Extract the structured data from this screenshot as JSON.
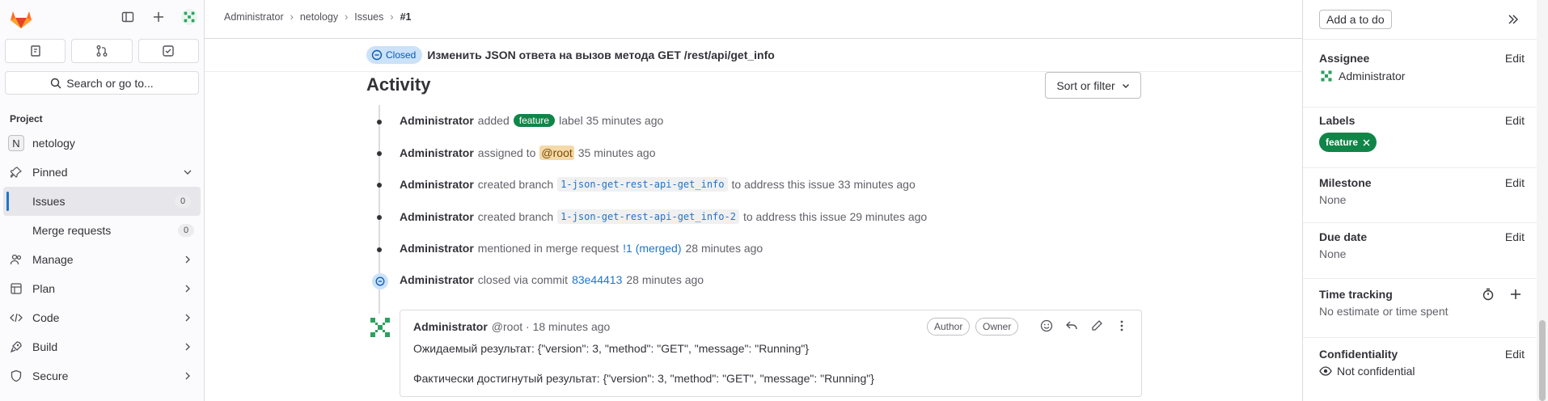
{
  "sidebar": {
    "search_label": "Search or go to...",
    "section": "Project",
    "project_name": "netology",
    "project_initial": "N",
    "pinned": "Pinned",
    "issues": "Issues",
    "issues_count": "0",
    "merge_requests": "Merge requests",
    "mr_count": "0",
    "manage": "Manage",
    "plan": "Plan",
    "code": "Code",
    "build": "Build",
    "secure": "Secure"
  },
  "breadcrumb": [
    "Administrator",
    "netology",
    "Issues",
    "#1"
  ],
  "issue": {
    "status": "Closed",
    "title": "Изменить JSON ответа на вызов метода GET /rest/api/get_info"
  },
  "activity": {
    "heading": "Activity",
    "sort_label": "Sort or filter",
    "events": {
      "e1": {
        "user": "Administrator",
        "pre": "added",
        "label": "feature",
        "post": "label 35 minutes ago"
      },
      "e2": {
        "user": "Administrator",
        "pre": "assigned to",
        "mention": "@root",
        "post": "35 minutes ago"
      },
      "e3": {
        "user": "Administrator",
        "pre": "created branch",
        "branch": "1-json-get-rest-api-get_info",
        "post": "to address this issue 33 minutes ago"
      },
      "e4": {
        "user": "Administrator",
        "pre": "created branch",
        "branch": "1-json-get-rest-api-get_info-2",
        "post": "to address this issue 29 minutes ago"
      },
      "e5": {
        "user": "Administrator",
        "pre": "mentioned in merge request",
        "link": "!1 (merged)",
        "post": "28 minutes ago"
      },
      "e6": {
        "user": "Administrator",
        "pre": "closed via commit",
        "link": "83e44413",
        "post": "28 minutes ago"
      }
    },
    "comment": {
      "user": "Administrator",
      "meta": "@root · 18 minutes ago",
      "role_author": "Author",
      "role_owner": "Owner",
      "line1": "Ожидаемый результат: {\"version\": 3, \"method\": \"GET\", \"message\": \"Running\"}",
      "line2": "Фактически достигнутый результат: {\"version\": 3, \"method\": \"GET\", \"message\": \"Running\"}"
    }
  },
  "right": {
    "todo": "Add a to do",
    "edit": "Edit",
    "assignee_title": "Assignee",
    "assignee": "Administrator",
    "labels_title": "Labels",
    "label": "feature",
    "milestone_title": "Milestone",
    "milestone": "None",
    "due_title": "Due date",
    "due": "None",
    "time_title": "Time tracking",
    "time": "No estimate or time spent",
    "conf_title": "Confidentiality",
    "conf": "Not confidential"
  },
  "colors": {
    "accent": "#1f75cb",
    "label": "#108548",
    "closed_bg": "#cbe2f9"
  }
}
